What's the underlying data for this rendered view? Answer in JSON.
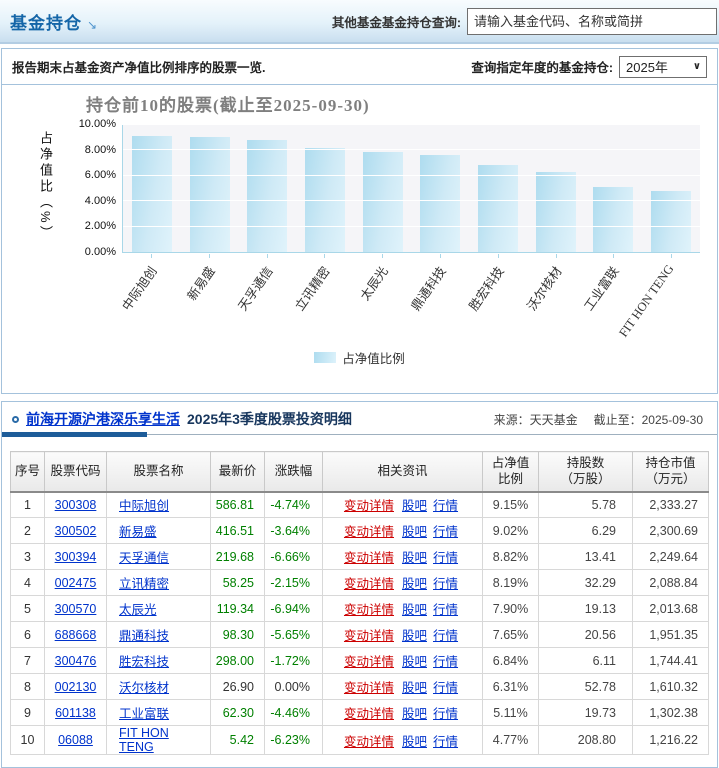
{
  "header": {
    "title": "基金持仓",
    "search_label": "其他基金基金持仓查询:",
    "search_placeholder": "请输入基金代码、名称或简拼"
  },
  "filter": {
    "description": "报告期末占基金资产净值比例排序的股票一览.",
    "year_label": "查询指定年度的基金持仓:",
    "year_selected": "2025年"
  },
  "chart_data": {
    "type": "bar",
    "title": "持仓前10的股票(截止至2025-09-30)",
    "ylabel": "占净值比（%）",
    "xlabel": "",
    "categories": [
      "中际旭创",
      "新易盛",
      "天孚通信",
      "立讯精密",
      "太辰光",
      "鼎通科技",
      "胜宏科技",
      "沃尔核材",
      "工业富联",
      "FIT HON TENG"
    ],
    "values": [
      9.15,
      9.02,
      8.82,
      8.19,
      7.9,
      7.65,
      6.84,
      6.31,
      5.11,
      4.77
    ],
    "ylim": [
      0,
      10
    ],
    "yticks": [
      0,
      2,
      4,
      6,
      8,
      10
    ],
    "ytick_labels": [
      "0.00%",
      "2.00%",
      "4.00%",
      "6.00%",
      "8.00%",
      "10.00%"
    ],
    "grid": true,
    "legend": "占净值比例",
    "legend_position": "bottom",
    "bar_color_start": "#aedcef",
    "bar_color_end": "#ddf2fb"
  },
  "detail": {
    "fund_link": "前海开源沪港深乐享生活",
    "section_title": "2025年3季度股票投资明细",
    "source": "来源：天天基金",
    "asof": "截止至：2025-09-30"
  },
  "table": {
    "headers": [
      "序号",
      "股票代码",
      "股票名称",
      "最新价",
      "涨跌幅",
      "相关资讯",
      "占净值\n比例",
      "持股数\n（万股）",
      "持仓市值\n（万元）"
    ],
    "link_labels": {
      "detail": "变动详情",
      "guba": "股吧",
      "quote": "行情"
    },
    "rows": [
      {
        "no": "1",
        "code": "300308",
        "name": "中际旭创",
        "price": "586.81",
        "change": "-4.74%",
        "ratio": "9.15%",
        "shares": "5.78",
        "value": "2,333.27",
        "trend": "down"
      },
      {
        "no": "2",
        "code": "300502",
        "name": "新易盛",
        "price": "416.51",
        "change": "-3.64%",
        "ratio": "9.02%",
        "shares": "6.29",
        "value": "2,300.69",
        "trend": "down"
      },
      {
        "no": "3",
        "code": "300394",
        "name": "天孚通信",
        "price": "219.68",
        "change": "-6.66%",
        "ratio": "8.82%",
        "shares": "13.41",
        "value": "2,249.64",
        "trend": "down"
      },
      {
        "no": "4",
        "code": "002475",
        "name": "立讯精密",
        "price": "58.25",
        "change": "-2.15%",
        "ratio": "8.19%",
        "shares": "32.29",
        "value": "2,088.84",
        "trend": "down"
      },
      {
        "no": "5",
        "code": "300570",
        "name": "太辰光",
        "price": "119.34",
        "change": "-6.94%",
        "ratio": "7.90%",
        "shares": "19.13",
        "value": "2,013.68",
        "trend": "down"
      },
      {
        "no": "6",
        "code": "688668",
        "name": "鼎通科技",
        "price": "98.30",
        "change": "-5.65%",
        "ratio": "7.65%",
        "shares": "20.56",
        "value": "1,951.35",
        "trend": "down"
      },
      {
        "no": "7",
        "code": "300476",
        "name": "胜宏科技",
        "price": "298.00",
        "change": "-1.72%",
        "ratio": "6.84%",
        "shares": "6.11",
        "value": "1,744.41",
        "trend": "down"
      },
      {
        "no": "8",
        "code": "002130",
        "name": "沃尔核材",
        "price": "26.90",
        "change": "0.00%",
        "ratio": "6.31%",
        "shares": "52.78",
        "value": "1,610.32",
        "trend": "flat"
      },
      {
        "no": "9",
        "code": "601138",
        "name": "工业富联",
        "price": "62.30",
        "change": "-4.46%",
        "ratio": "5.11%",
        "shares": "19.73",
        "value": "1,302.38",
        "trend": "down"
      },
      {
        "no": "10",
        "code": "06088",
        "name": "FIT HON TENG",
        "price": "5.42",
        "change": "-6.23%",
        "ratio": "4.77%",
        "shares": "208.80",
        "value": "1,216.22",
        "trend": "down"
      }
    ]
  }
}
